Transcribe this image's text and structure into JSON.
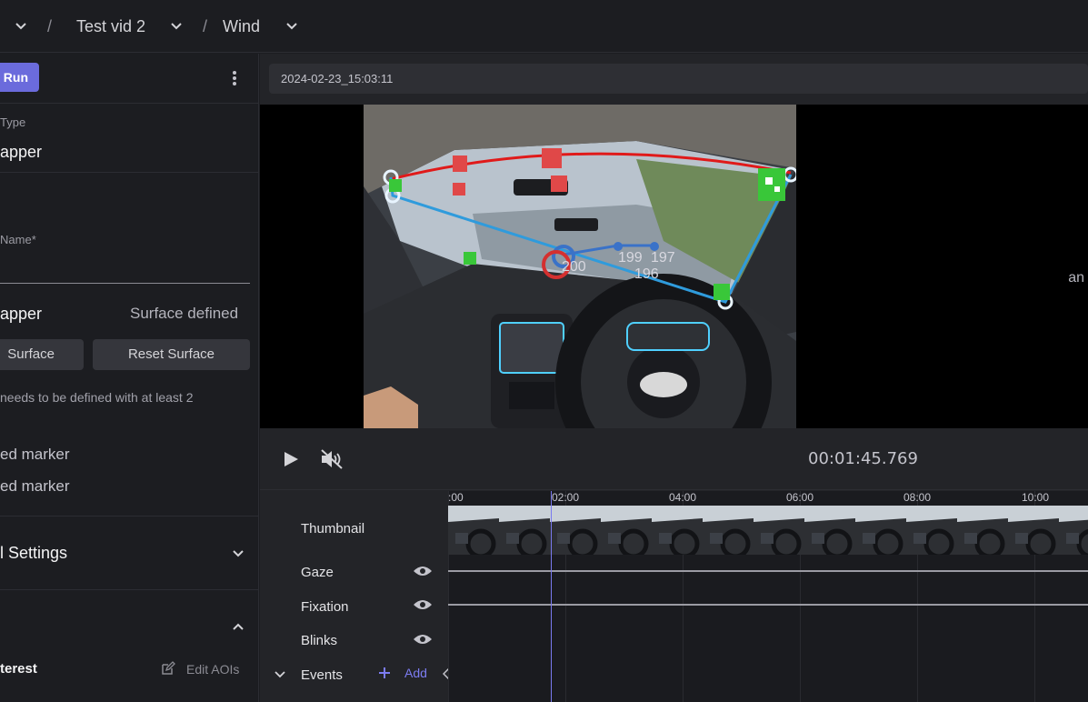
{
  "breadcrumb": {
    "items": [
      {
        "label": ""
      },
      {
        "label": "Test vid 2"
      },
      {
        "label": "Wind"
      }
    ],
    "separator": "/"
  },
  "left_panel": {
    "run_label": "Run",
    "type_label": "Type",
    "type_value": "apper",
    "name_label": "Name",
    "name_required_mark": "*",
    "name_value": "",
    "mapper_label": "apper",
    "surface_status": "Surface defined",
    "define_surface_label": "Surface",
    "reset_surface_label": "Reset Surface",
    "hint_text": "needs to be defined with at least 2",
    "marker_lines": [
      "ed marker",
      "ed marker"
    ],
    "settings_label": "l Settings",
    "interest_label": "terest",
    "edit_aois_label": "Edit AOIs"
  },
  "player": {
    "recording_timestamp": "2024-02-23_15:03:11",
    "side_text": "an",
    "time_display": "00:01:45.769",
    "overlay_numbers": [
      "200",
      "199",
      "197",
      "196"
    ]
  },
  "timeline": {
    "ticks": [
      ":00",
      "02:00",
      "04:00",
      "06:00",
      "08:00",
      "10:00"
    ],
    "tracks": [
      {
        "label": "Thumbnail"
      },
      {
        "label": "Gaze"
      },
      {
        "label": "Fixation"
      },
      {
        "label": "Blinks"
      },
      {
        "label": "Events"
      }
    ],
    "add_label": "Add"
  },
  "colors": {
    "accent": "#6b6bdc",
    "panel_bg": "#1c1d21",
    "surface_outline": "#2f9bdc",
    "surface_top": "#e01a1a",
    "marker_green": "#39c739"
  }
}
